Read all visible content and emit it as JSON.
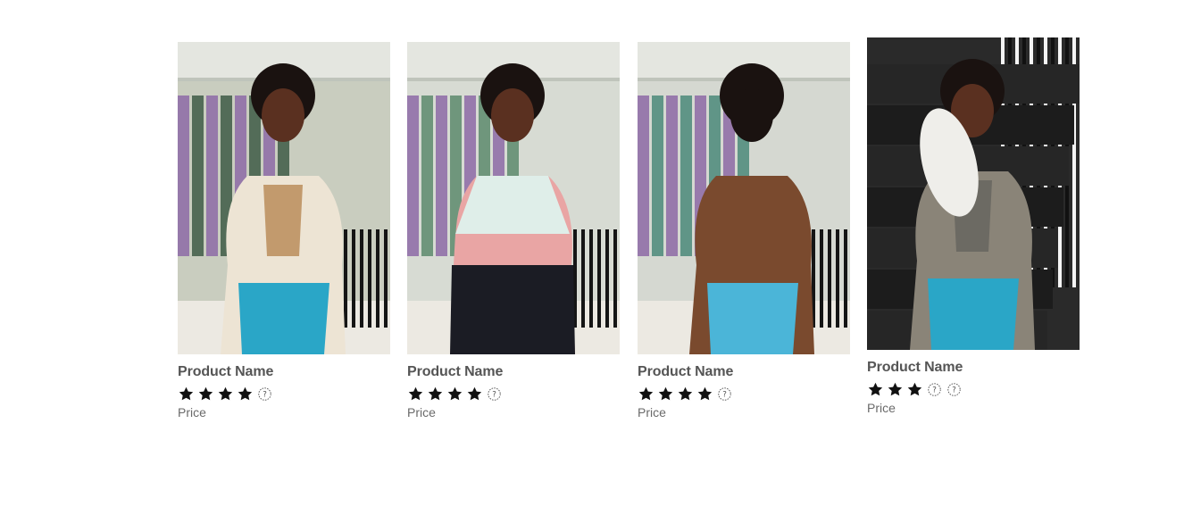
{
  "products": [
    {
      "name": "Product Name",
      "price": "Price",
      "rating": 4,
      "max_rating": 5,
      "image_icon": "fleece-jacket-photo",
      "palette": {
        "bg": "#c9cdbf",
        "rack": "#3e5b45",
        "top": "#ede4d4",
        "inner": "#c29a6d",
        "bottom": "#2aa6c7",
        "skin": "#5a3020",
        "hair": "#1a1210"
      }
    },
    {
      "name": "Product Name",
      "price": "Price",
      "rating": 4,
      "max_rating": 5,
      "image_icon": "colorblock-jacket-photo",
      "palette": {
        "bg": "#d7dbd3",
        "rack": "#5d8a6c",
        "top": "#e9a5a4",
        "inner": "#1b1c24",
        "bottom": "#2aa6c7",
        "skin": "#5a3020",
        "hair": "#1a1210"
      }
    },
    {
      "name": "Product Name",
      "price": "Price",
      "rating": 4,
      "max_rating": 5,
      "image_icon": "corduroy-jacket-photo",
      "palette": {
        "bg": "#d5d8d1",
        "rack": "#4b8a7a",
        "top": "#7a4a2e",
        "inner": "#6a3f25",
        "bottom": "#4bb5d8",
        "skin": "#5a3020",
        "hair": "#1a1210"
      }
    },
    {
      "name": "Product Name",
      "price": "Price",
      "rating": 3,
      "max_rating": 5,
      "image_icon": "staircase-sneaker-photo",
      "palette": {
        "bg": "#2a2a2a",
        "rack": "#f2f2f2",
        "top": "#8a8478",
        "inner": "#6c6a63",
        "bottom": "#2aa6c7",
        "skin": "#5a3020",
        "hair": "#1a1210"
      }
    }
  ]
}
